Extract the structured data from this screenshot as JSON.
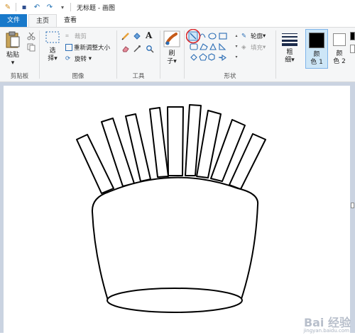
{
  "titlebar": {
    "title": "无标题 - 画图",
    "icons": [
      "paint-app-icon",
      "save-icon",
      "undo-icon",
      "redo-icon",
      "customize-dropdown-icon"
    ]
  },
  "tabs": [
    {
      "label": "文件",
      "active": false
    },
    {
      "label": "主页",
      "active": true
    },
    {
      "label": "查看",
      "active": false
    }
  ],
  "ribbon": {
    "clipboard": {
      "group_label": "剪贴板",
      "paste_label": "粘贴"
    },
    "image": {
      "group_label": "图像",
      "select_label_1": "选",
      "select_label_2": "择",
      "crop_label": "裁剪",
      "resize_label": "重新调整大小",
      "rotate_label": "旋转"
    },
    "tools": {
      "group_label": "工具"
    },
    "brushes": {
      "label_1": "刷",
      "label_2": "子"
    },
    "shapes": {
      "group_label": "形状",
      "outline_label": "轮廓",
      "fill_label": "填充"
    },
    "size": {
      "label_1": "粗",
      "label_2": "细"
    },
    "colors": {
      "color1_label_1": "颜",
      "color1_label_2": "色 1",
      "color2_label_1": "颜",
      "color2_label_2": "色 2",
      "color1_value": "#000000",
      "color2_value": "#ffffff"
    }
  },
  "accent_color": "#1979ca",
  "highlight_color": "#d9262b",
  "watermark": {
    "text": "Bai 经验",
    "url": "jingyan.baidu.com"
  }
}
